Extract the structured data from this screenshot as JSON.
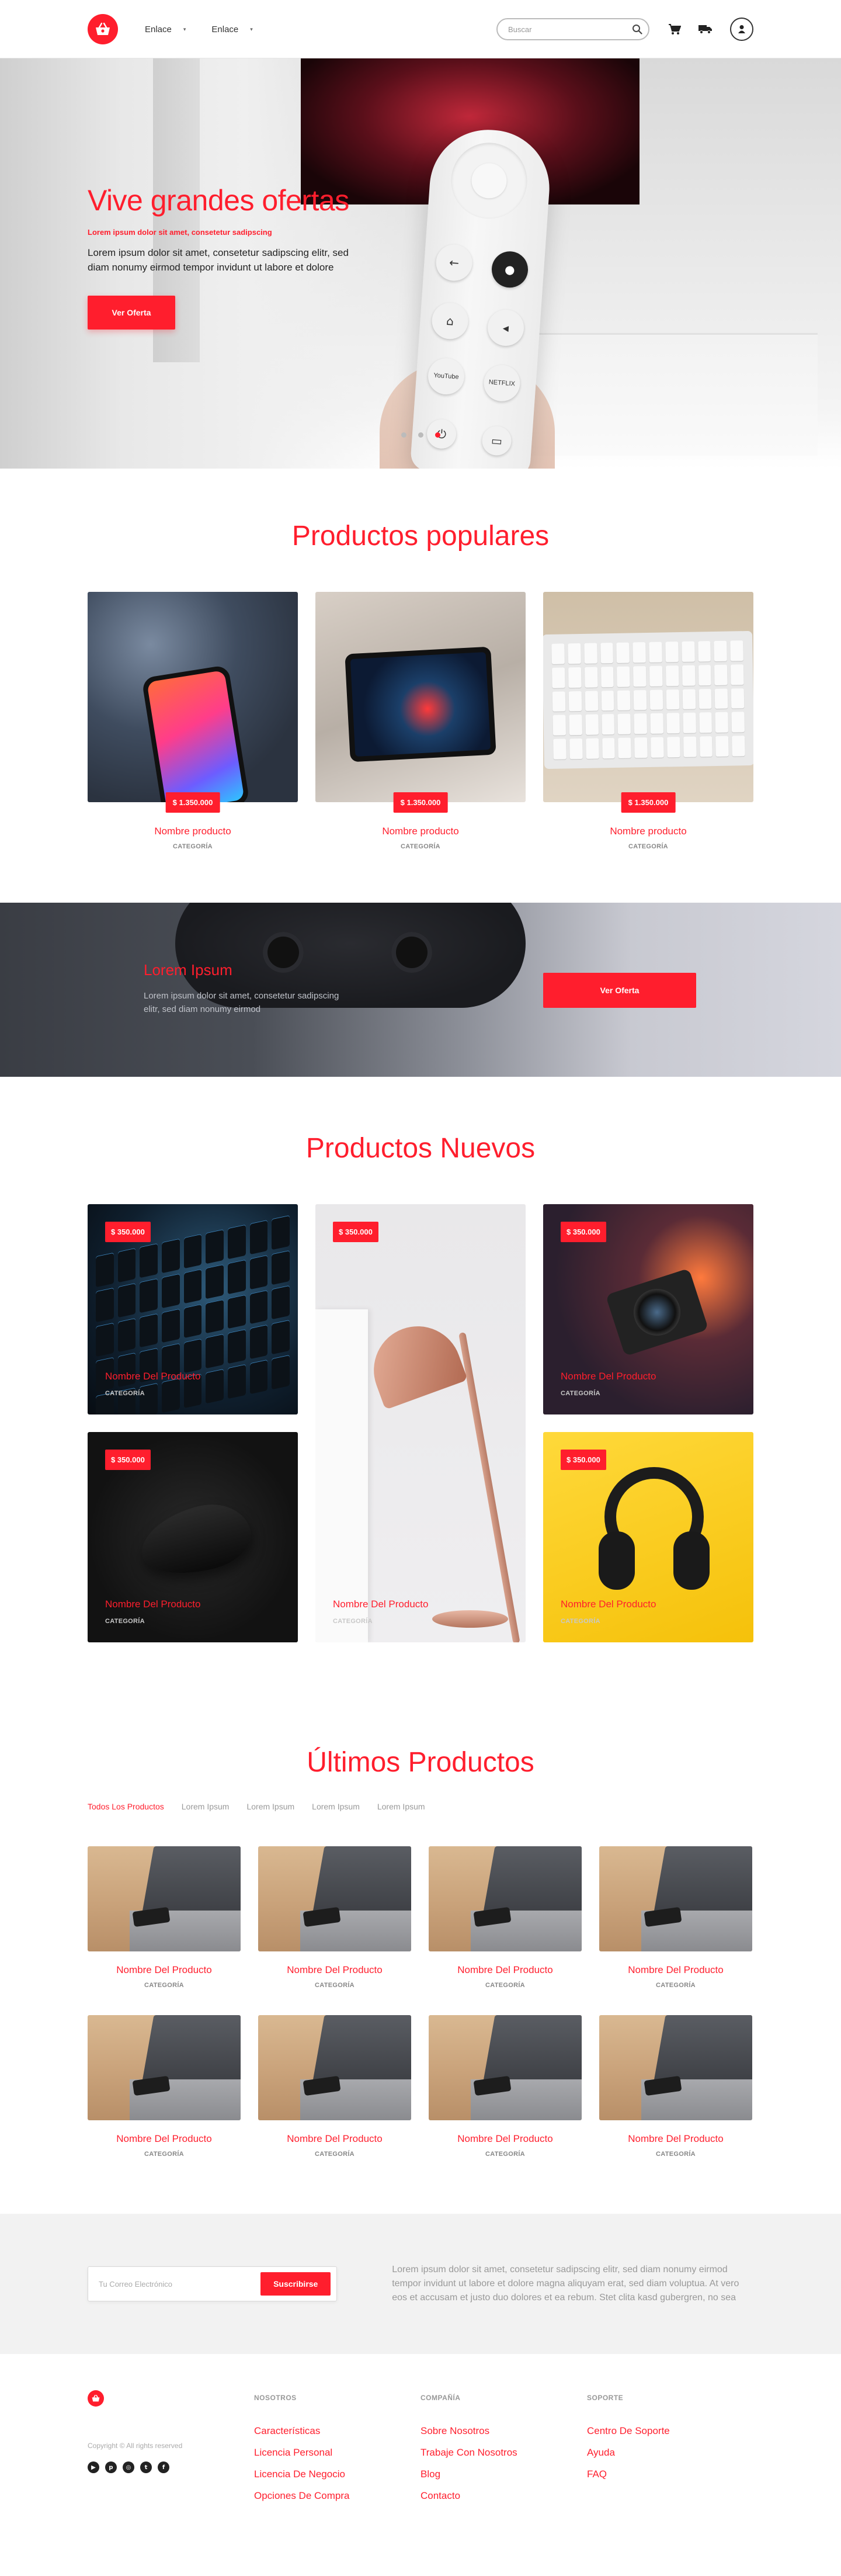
{
  "header": {
    "nav": [
      {
        "label": "Enlace",
        "caret": "▾"
      },
      {
        "label": "Enlace",
        "caret": "▾"
      }
    ],
    "search_placeholder": "Buscar"
  },
  "hero": {
    "title": "Vive grandes ofertas",
    "kicker": "Lorem ipsum dolor sit amet, consetetur sadipscing",
    "text": "Lorem ipsum dolor sit amet, consetetur sadipscing elitr, sed diam nonumy eirmod tempor invidunt ut labore et dolore",
    "button": "Ver Oferta",
    "slides": 3,
    "active_slide": 3,
    "remote_buttons": {
      "youtube": "YouTube",
      "netflix": "NETFLIX"
    }
  },
  "popular": {
    "title": "Productos populares",
    "items": [
      {
        "price": "$ 1.350.000",
        "name": "Nombre producto",
        "category": "CATEGORÍA"
      },
      {
        "price": "$ 1.350.000",
        "name": "Nombre producto",
        "category": "CATEGORÍA"
      },
      {
        "price": "$ 1.350.000",
        "name": "Nombre producto",
        "category": "CATEGORÍA"
      }
    ]
  },
  "banner": {
    "title": "Lorem Ipsum",
    "text": "Lorem ipsum dolor sit amet, consetetur sadipscing elitr, sed diam nonumy eirmod",
    "button": "Ver Oferta"
  },
  "new_products": {
    "title": "Productos Nuevos",
    "items": [
      {
        "price": "$ 350.000",
        "name": "Nombre Del Producto",
        "category": "CATEGORÍA"
      },
      {
        "price": "$ 350.000",
        "name": "Nombre Del Producto",
        "category": "CATEGORÍA"
      },
      {
        "price": "$ 350.000",
        "name": "Nombre Del Producto",
        "category": "CATEGORÍA"
      },
      {
        "price": "$ 350.000",
        "name": "Nombre Del Producto",
        "category": "CATEGORÍA"
      },
      {
        "price": "$ 350.000",
        "name": "Nombre Del Producto",
        "category": "CATEGORÍA"
      }
    ]
  },
  "latest": {
    "title": "Últimos Productos",
    "tabs": [
      "Todos Los Productos",
      "Lorem Ipsum",
      "Lorem Ipsum",
      "Lorem Ipsum",
      "Lorem Ipsum"
    ],
    "item": {
      "name": "Nombre Del Producto",
      "category": "CATEGORÍA"
    }
  },
  "newsletter": {
    "placeholder": "Tu Correo Electrónico",
    "button": "Suscribirse",
    "text": "Lorem ipsum dolor sit amet, consetetur sadipscing elitr, sed diam nonumy eirmod tempor invidunt ut labore et dolore magna aliquyam erat, sed diam voluptua. At vero eos et accusam et justo duo dolores et ea rebum. Stet clita kasd gubergren, no sea"
  },
  "footer": {
    "copyright": "Copyright © All rights reserved",
    "columns": [
      {
        "heading": "NOSOTROS",
        "links": [
          "Características",
          "Licencia Personal",
          "Licencia De Negocio",
          "Opciones De Compra"
        ]
      },
      {
        "heading": "COMPAÑÍA",
        "links": [
          "Sobre Nosotros",
          "Trabaje Con Nosotros",
          "Blog",
          "Contacto"
        ]
      },
      {
        "heading": "SOPORTE",
        "links": [
          "Centro De Soporte",
          "Ayuda",
          "FAQ"
        ]
      }
    ],
    "socials": [
      "youtube-icon",
      "pinterest-icon",
      "instagram-icon",
      "twitter-icon",
      "facebook-icon"
    ]
  },
  "colors": {
    "accent": "#ff1e2d",
    "muted": "#999999",
    "newsletter_bg": "#f2f2f2"
  }
}
